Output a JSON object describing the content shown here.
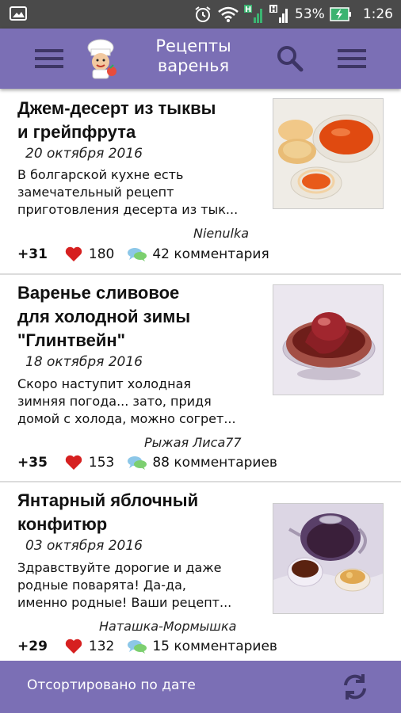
{
  "status_bar": {
    "battery_percent": "53%",
    "time": "1:26",
    "icons": [
      "image-notification-icon",
      "alarm-icon",
      "wifi-icon",
      "signal-h-icon",
      "signal-icon",
      "battery-charging-icon"
    ]
  },
  "app_bar": {
    "title_line1": "Рецепты",
    "title_line2": "варенья",
    "icons": [
      "drawer-menu-icon",
      "chef-logo-icon",
      "search-icon",
      "overflow-menu-icon"
    ],
    "bg_color": "#7b6fb5"
  },
  "recipes": [
    {
      "title_line1": "Джем-десерт из тыквы",
      "title_line2": "и грейпфрута",
      "date": "20 октября 2016",
      "desc_line1": "В болгарской кухне есть",
      "desc_line2": "замечательный рецепт",
      "desc_line3": "приготовления десерта из тык...",
      "author": "Nienulka",
      "score": "+31",
      "likes": "180",
      "comments": "42 комментария",
      "image": "pumpkin-jam-photo"
    },
    {
      "title_line1": "Варенье сливовое",
      "title_line2": "для холодной зимы",
      "title_line3": "\"Глинтвейн\"",
      "date": "18 октября 2016",
      "desc_line1": "Скоро наступит холодная",
      "desc_line2": "зимняя погода... зато, придя",
      "desc_line3": "домой с холода, можно согрет...",
      "author": "Рыжая Лиса77",
      "score": "+35",
      "likes": "153",
      "comments": "88 комментариев",
      "image": "plum-jam-photo"
    },
    {
      "title_line1": "Янтарный яблочный",
      "title_line2": "конфитюр",
      "date": "03 октября 2016",
      "desc_line1": "Здравствуйте дорогие и даже",
      "desc_line2": "родные поварята! Да-да,",
      "desc_line3": "именно родные! Ваши рецепт...",
      "author": "Наташка-Мормышка",
      "score": "+29",
      "likes": "132",
      "comments": "15 комментариев",
      "image": "apple-confiture-photo"
    }
  ],
  "bottom_bar": {
    "sort_label": "Отсортировано по дате",
    "icon": "refresh-icon"
  }
}
